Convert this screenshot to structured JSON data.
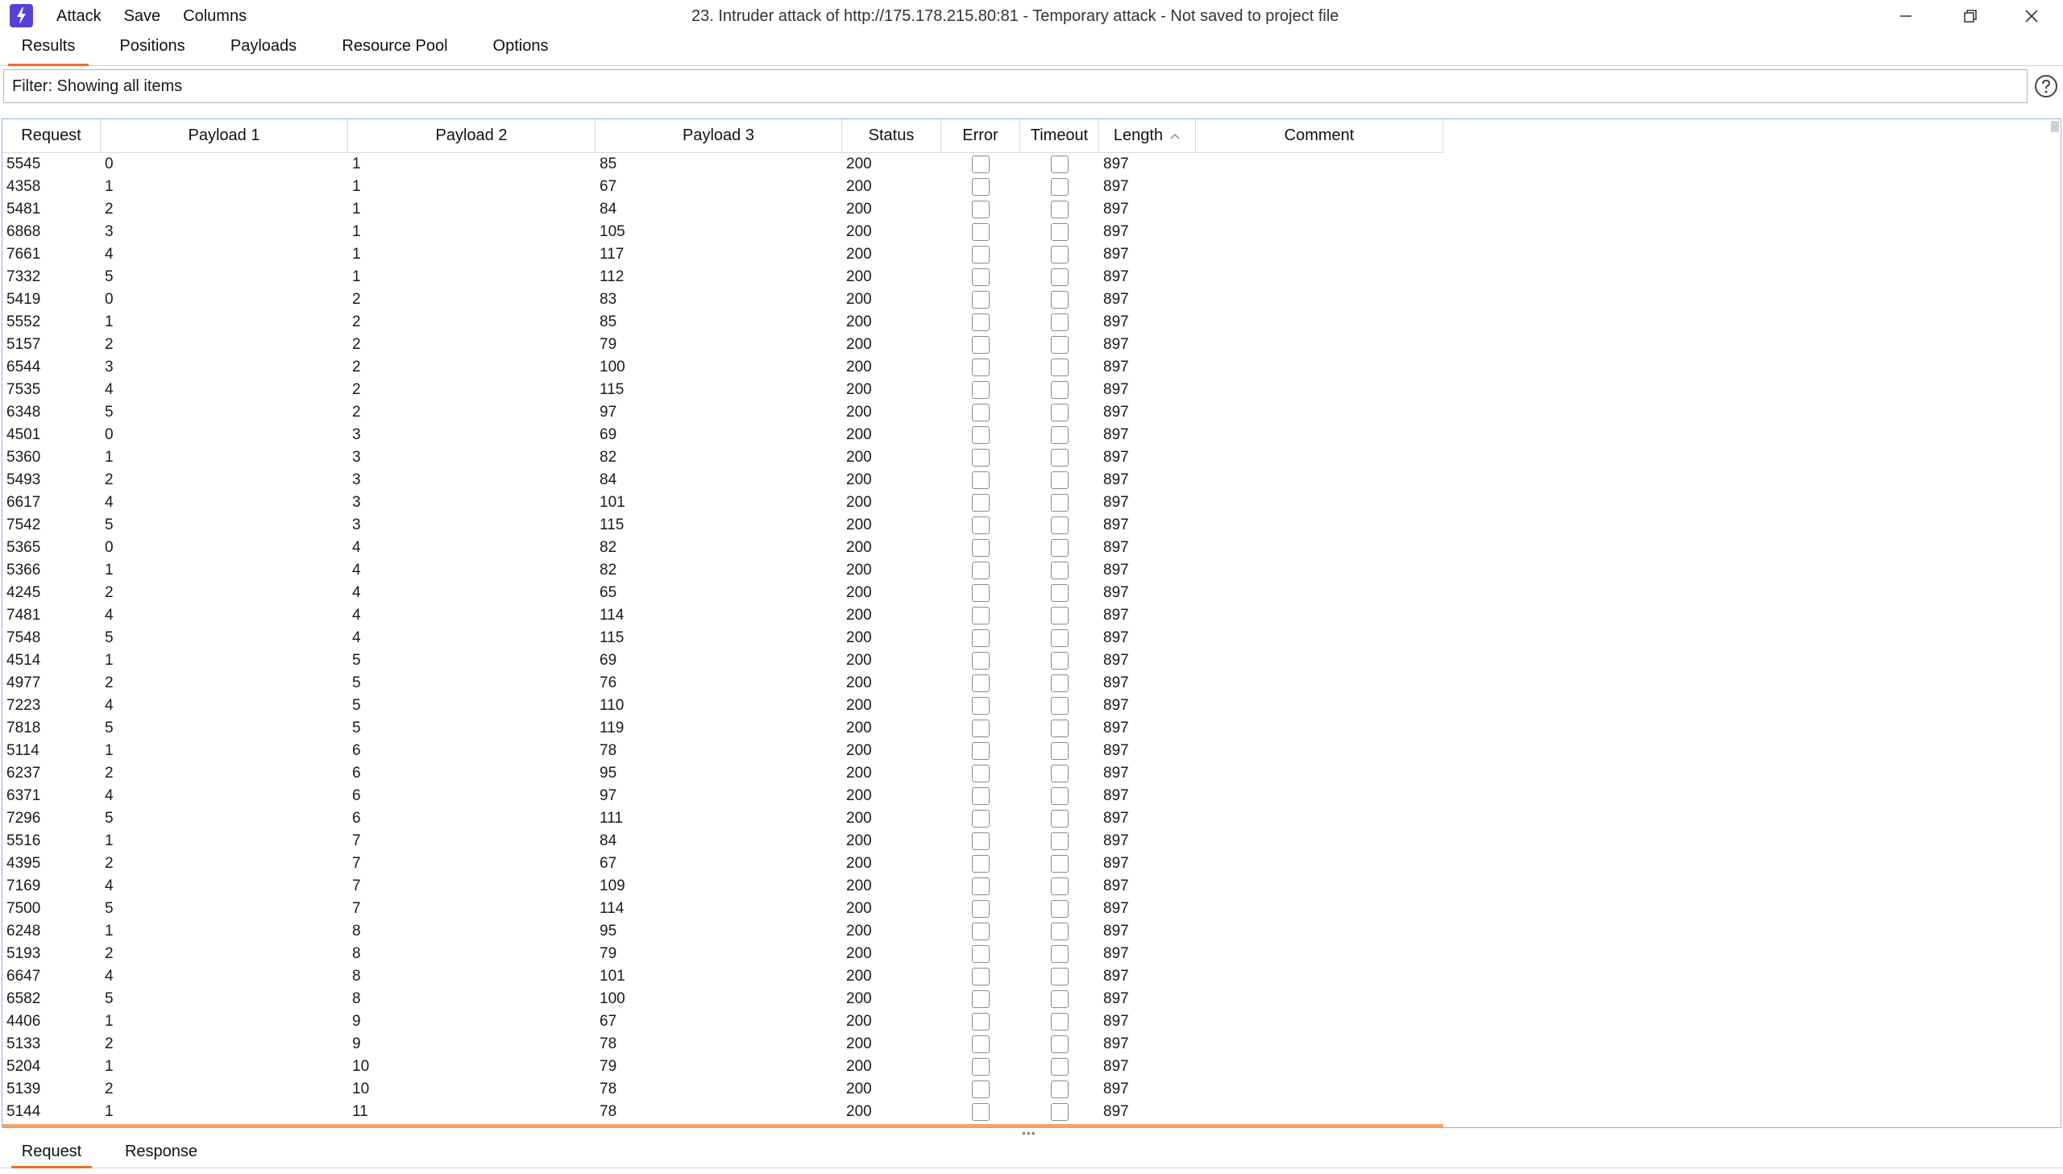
{
  "window": {
    "title": "23. Intruder attack of http://175.178.215.80:81 - Temporary attack - Not saved to project file",
    "menu": [
      "Attack",
      "Save",
      "Columns"
    ]
  },
  "tabs": [
    {
      "label": "Results",
      "active": true
    },
    {
      "label": "Positions",
      "active": false
    },
    {
      "label": "Payloads",
      "active": false
    },
    {
      "label": "Resource Pool",
      "active": false
    },
    {
      "label": "Options",
      "active": false
    }
  ],
  "filter": {
    "text": "Filter: Showing all items"
  },
  "table": {
    "columns": [
      "Request",
      "Payload 1",
      "Payload 2",
      "Payload 3",
      "Status",
      "Error",
      "Timeout",
      "Length",
      "Comment"
    ],
    "sorted_column": "Length",
    "sort_direction": "ascending",
    "rows": [
      [
        "5545",
        "0",
        "1",
        "85",
        "200",
        "897"
      ],
      [
        "4358",
        "1",
        "1",
        "67",
        "200",
        "897"
      ],
      [
        "5481",
        "2",
        "1",
        "84",
        "200",
        "897"
      ],
      [
        "6868",
        "3",
        "1",
        "105",
        "200",
        "897"
      ],
      [
        "7661",
        "4",
        "1",
        "117",
        "200",
        "897"
      ],
      [
        "7332",
        "5",
        "1",
        "112",
        "200",
        "897"
      ],
      [
        "5419",
        "0",
        "2",
        "83",
        "200",
        "897"
      ],
      [
        "5552",
        "1",
        "2",
        "85",
        "200",
        "897"
      ],
      [
        "5157",
        "2",
        "2",
        "79",
        "200",
        "897"
      ],
      [
        "6544",
        "3",
        "2",
        "100",
        "200",
        "897"
      ],
      [
        "7535",
        "4",
        "2",
        "115",
        "200",
        "897"
      ],
      [
        "6348",
        "5",
        "2",
        "97",
        "200",
        "897"
      ],
      [
        "4501",
        "0",
        "3",
        "69",
        "200",
        "897"
      ],
      [
        "5360",
        "1",
        "3",
        "82",
        "200",
        "897"
      ],
      [
        "5493",
        "2",
        "3",
        "84",
        "200",
        "897"
      ],
      [
        "6617",
        "4",
        "3",
        "101",
        "200",
        "897"
      ],
      [
        "7542",
        "5",
        "3",
        "115",
        "200",
        "897"
      ],
      [
        "5365",
        "0",
        "4",
        "82",
        "200",
        "897"
      ],
      [
        "5366",
        "1",
        "4",
        "82",
        "200",
        "897"
      ],
      [
        "4245",
        "2",
        "4",
        "65",
        "200",
        "897"
      ],
      [
        "7481",
        "4",
        "4",
        "114",
        "200",
        "897"
      ],
      [
        "7548",
        "5",
        "4",
        "115",
        "200",
        "897"
      ],
      [
        "4514",
        "1",
        "5",
        "69",
        "200",
        "897"
      ],
      [
        "4977",
        "2",
        "5",
        "76",
        "200",
        "897"
      ],
      [
        "7223",
        "4",
        "5",
        "110",
        "200",
        "897"
      ],
      [
        "7818",
        "5",
        "5",
        "119",
        "200",
        "897"
      ],
      [
        "5114",
        "1",
        "6",
        "78",
        "200",
        "897"
      ],
      [
        "6237",
        "2",
        "6",
        "95",
        "200",
        "897"
      ],
      [
        "6371",
        "4",
        "6",
        "97",
        "200",
        "897"
      ],
      [
        "7296",
        "5",
        "6",
        "111",
        "200",
        "897"
      ],
      [
        "5516",
        "1",
        "7",
        "84",
        "200",
        "897"
      ],
      [
        "4395",
        "2",
        "7",
        "67",
        "200",
        "897"
      ],
      [
        "7169",
        "4",
        "7",
        "109",
        "200",
        "897"
      ],
      [
        "7500",
        "5",
        "7",
        "114",
        "200",
        "897"
      ],
      [
        "6248",
        "1",
        "8",
        "95",
        "200",
        "897"
      ],
      [
        "5193",
        "2",
        "8",
        "79",
        "200",
        "897"
      ],
      [
        "6647",
        "4",
        "8",
        "101",
        "200",
        "897"
      ],
      [
        "6582",
        "5",
        "8",
        "100",
        "200",
        "897"
      ],
      [
        "4406",
        "1",
        "9",
        "67",
        "200",
        "897"
      ],
      [
        "5133",
        "2",
        "9",
        "78",
        "200",
        "897"
      ],
      [
        "5204",
        "1",
        "10",
        "79",
        "200",
        "897"
      ],
      [
        "5139",
        "2",
        "10",
        "78",
        "200",
        "897"
      ],
      [
        "5144",
        "1",
        "11",
        "78",
        "200",
        "897"
      ]
    ]
  },
  "bottom_tabs": [
    {
      "label": "Request",
      "active": true
    },
    {
      "label": "Response",
      "active": false
    }
  ],
  "colors": {
    "accent": "#f26b26",
    "app_icon": "#5b3fd4",
    "table_border": "#8fb0d9"
  }
}
